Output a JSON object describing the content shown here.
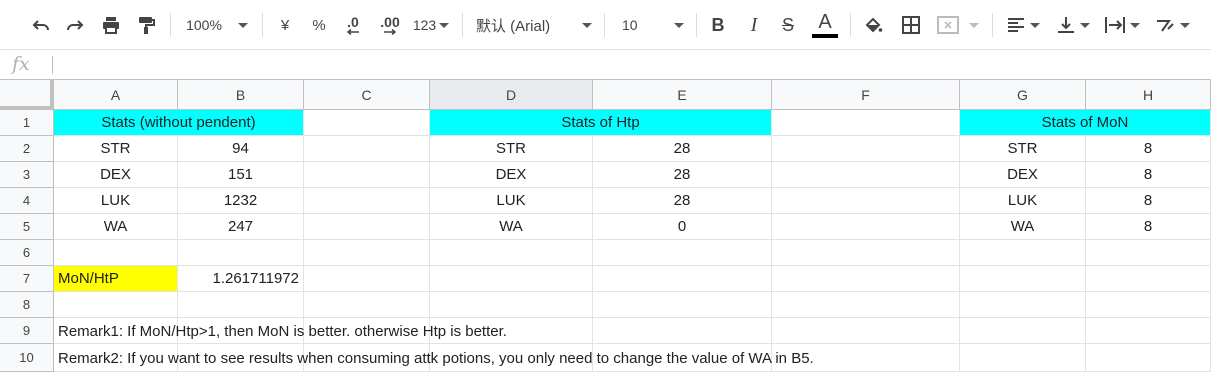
{
  "toolbar": {
    "zoom": "100%",
    "currency": "¥",
    "percent": "%",
    "decrease_decimal": ".0",
    "increase_decimal": ".00",
    "number_format": "123",
    "font": "默认 (Arial)",
    "font_size": "10",
    "bold": "B",
    "italic": "I",
    "strike": "S",
    "text_color_letter": "A"
  },
  "formula_bar": {
    "fx": "fx",
    "value": ""
  },
  "columns": [
    "A",
    "B",
    "C",
    "D",
    "E",
    "F",
    "G",
    "H"
  ],
  "rows": [
    "1",
    "2",
    "3",
    "4",
    "5",
    "6",
    "7",
    "8",
    "9",
    "10"
  ],
  "colors": {
    "header_fill": "#00ffff",
    "highlight_fill": "#ffff00"
  },
  "sheet": {
    "without_pendent": {
      "header": "Stats (without pendent)",
      "stats": [
        {
          "name": "STR",
          "value": "94"
        },
        {
          "name": "DEX",
          "value": "151"
        },
        {
          "name": "LUK",
          "value": "1232"
        },
        {
          "name": "WA",
          "value": "247"
        }
      ]
    },
    "htp": {
      "header": "Stats of Htp",
      "stats": [
        {
          "name": "STR",
          "value": "28"
        },
        {
          "name": "DEX",
          "value": "28"
        },
        {
          "name": "LUK",
          "value": "28"
        },
        {
          "name": "WA",
          "value": "0"
        }
      ]
    },
    "mon": {
      "header": "Stats of MoN",
      "stats": [
        {
          "name": "STR",
          "value": "8"
        },
        {
          "name": "DEX",
          "value": "8"
        },
        {
          "name": "LUK",
          "value": "8"
        },
        {
          "name": "WA",
          "value": "8"
        }
      ]
    },
    "ratio_label": "MoN/HtP",
    "ratio_value": "1.261711972",
    "remark1": "Remark1: If MoN/Htp>1, then MoN is better. otherwise Htp is better.",
    "remark2": "Remark2: If you want to see results when consuming attk potions, you only need to  change the value of WA in B5."
  }
}
